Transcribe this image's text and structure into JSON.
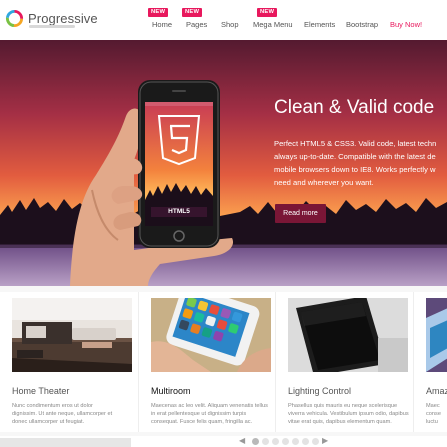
{
  "header": {
    "brand": "Progressive",
    "badges": [
      "NEW",
      "NEW",
      "NEW"
    ],
    "nav": [
      "Home",
      "Pages",
      "Shop",
      "Mega Menu",
      "Elements",
      "Bootstrap",
      "Buy Now!"
    ],
    "accent": "#e8185d"
  },
  "hero": {
    "title": "Clean & Valid code",
    "lines": [
      "Perfect HTML5 & CSS3. Valid code, latest techn",
      "always up-to-date. Compatible with the latest de",
      "mobile browsers down to IE8. Works perfectly w",
      "need and wherever you want."
    ],
    "button": "Read more",
    "phone_label": "HTML5"
  },
  "cards": [
    {
      "title": "Home Theater",
      "desc": [
        "Nunc condimentum eros ut dolor",
        "dignissim. Ut ante neque, ullamcorper et",
        "donec ullamcorper ut feugiat."
      ]
    },
    {
      "title": "Multiroom",
      "desc": [
        "Maecenas ac leo velit. Aliquam venenatis tellus",
        "in erat pellentesque ut dignissim turpis",
        "consequat. Fusce felis quam, fringilla ac."
      ]
    },
    {
      "title": "Lighting Control",
      "desc": [
        "Phasellus quis mauris eu neque scelerisque",
        "viverra vehicula. Vestibulum ipsum odio, dapibus",
        "vitae erat quis, dapibus elementum quam."
      ]
    },
    {
      "title": "Amaz",
      "desc": [
        "Maec",
        "conse",
        "luctu"
      ]
    }
  ],
  "pager": {
    "prev": "◀",
    "next": "▶",
    "dots": 7,
    "active_index": 0
  }
}
